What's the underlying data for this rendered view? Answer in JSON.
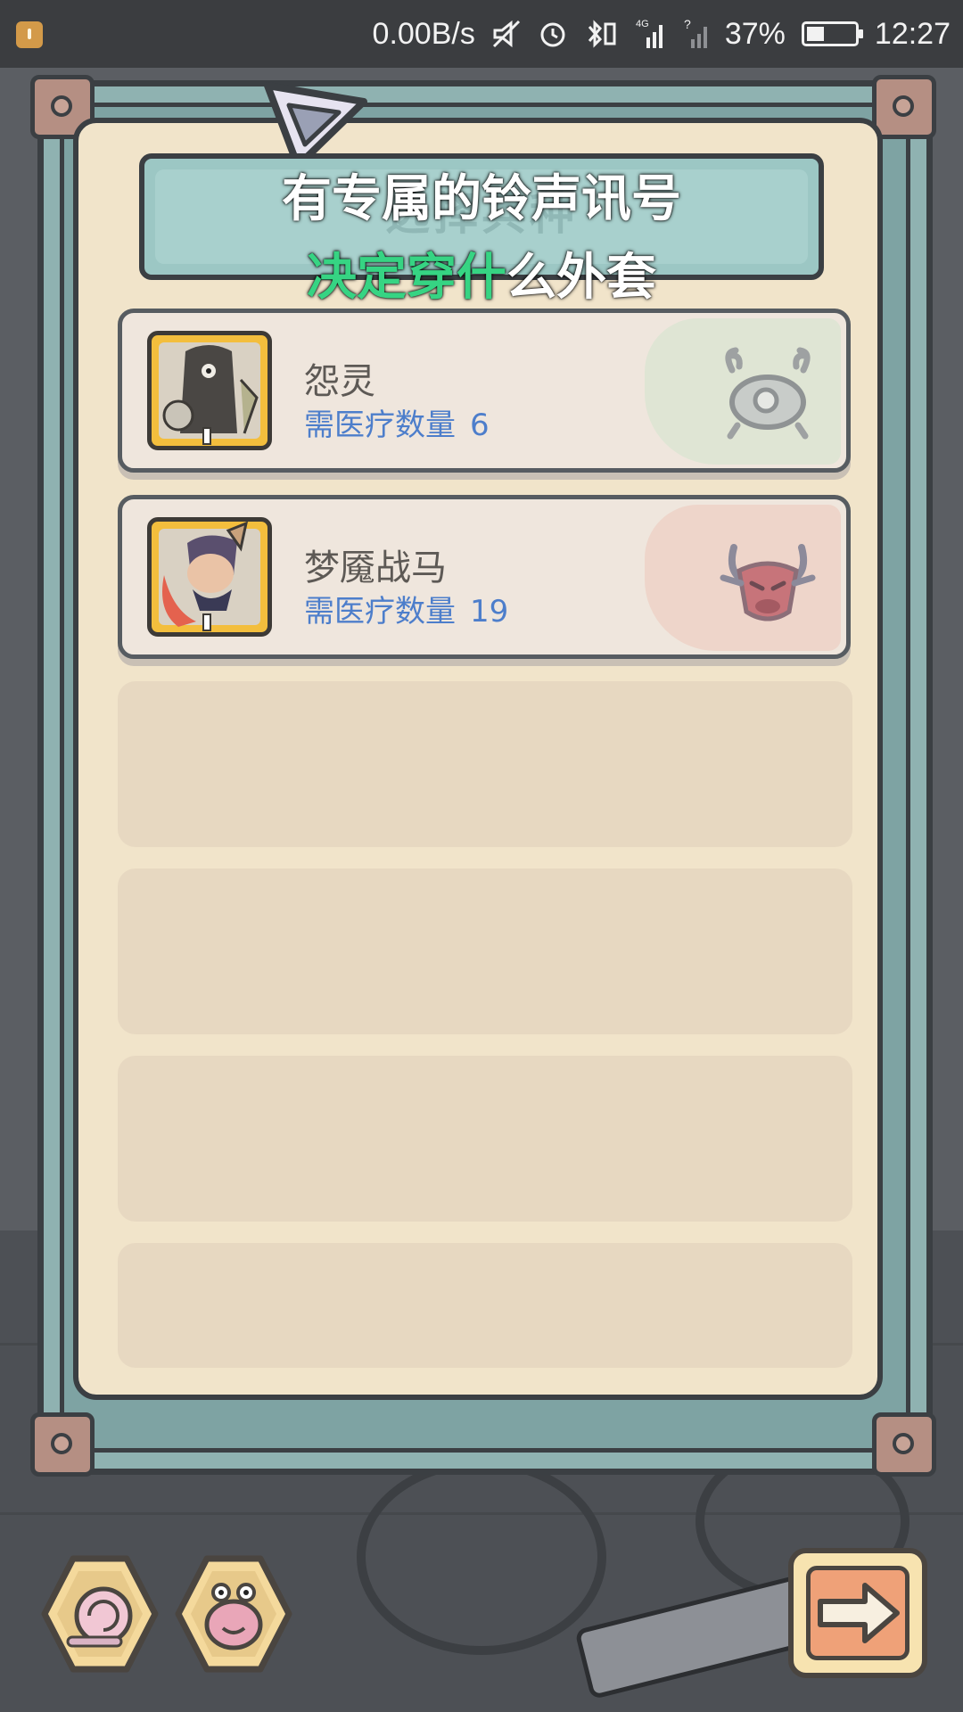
{
  "status_bar": {
    "net_speed": "0.00B/s",
    "network": "4G",
    "battery": "37%",
    "battery_level": 0.37,
    "time": "12:27"
  },
  "panel": {
    "title": "选择兵种"
  },
  "subtitle": {
    "line1": "有专属的铃声讯号",
    "line2_highlight": "决定穿什",
    "line2_rest": "么外套"
  },
  "units": [
    {
      "name": "怨灵",
      "need_label": "需医疗数量",
      "need_count": "6",
      "type_icon": "crab-eye-icon",
      "accent": "#dbe5d2"
    },
    {
      "name": "梦魇战马",
      "need_label": "需医疗数量",
      "need_count": "19",
      "type_icon": "bull-demon-icon",
      "accent": "#eed1c6"
    }
  ],
  "bottom_buttons": {
    "left_1": "snail-shell-icon",
    "left_2": "slug-creature-icon",
    "next": "arrow-right-icon"
  },
  "colors": {
    "need_text": "#4d7ecb",
    "panel_bg": "#f1e4ca",
    "frame_teal": "#8fb2b1",
    "highlight_green": "#36d483"
  }
}
